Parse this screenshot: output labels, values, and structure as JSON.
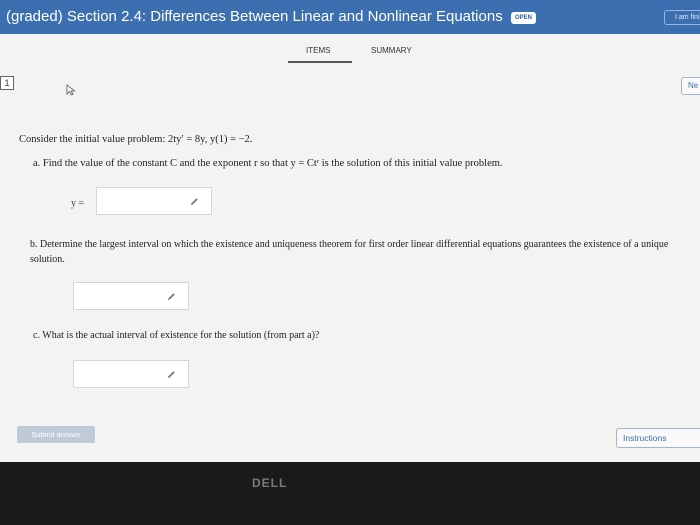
{
  "header": {
    "title": "(graded) Section 2.4: Differences Between Linear and Nonlinear Equations",
    "badge": "OPEN",
    "top_right_button": "I am fini"
  },
  "tabs": [
    {
      "label": "ITEMS"
    },
    {
      "label": "SUMMARY"
    }
  ],
  "question_number": "1",
  "next_button": "Ne",
  "problem": {
    "intro": "Consider the initial value problem: 2ty′ = 8y,   y(1) = −2.",
    "part_a": "a. Find the value of the constant C and the exponent r so that y = Ctʳ is the solution of this initial value problem.",
    "y_label": "y =",
    "part_b": "b. Determine the largest interval on which the existence and uniqueness theorem for first order linear differential equations guarantees the existence of a unique solution.",
    "part_c": "c. What is the actual interval of existence for the solution (from part a)?"
  },
  "icons": {
    "edit": "pencil-icon",
    "cursor": "cursor-icon"
  },
  "footer": {
    "submit_label": "Submit answer",
    "instructions_label": "Instructions"
  },
  "bezel_logo": "DELL",
  "colors": {
    "header_bg": "#3b6fb0",
    "page_bg": "#f3f3f2",
    "submit_bg": "#bfc9d8"
  }
}
